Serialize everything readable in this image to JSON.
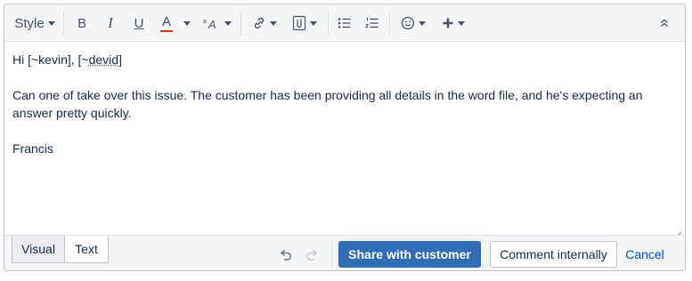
{
  "toolbar": {
    "style_label": "Style",
    "bold_label": "B",
    "italic_label": "I",
    "underline_label": "U",
    "text_color_label": "A",
    "text_color_value": "#de350b"
  },
  "content": {
    "line1_prefix": "Hi [~kevin], [~",
    "line1_misspelled": "devid",
    "line1_suffix": "]",
    "line2": "Can one of take over this issue.  The customer has been providing all details in the word file, and he's expecting an answer pretty quickly.",
    "line3": "Francis"
  },
  "footer": {
    "tab_visual": "Visual",
    "tab_text": "Text",
    "share_label": "Share with customer",
    "comment_label": "Comment internally",
    "cancel_label": "Cancel"
  },
  "colors": {
    "primary": "#2f6eb6",
    "link": "#0052cc",
    "toolbar_bg": "#f4f5f7"
  },
  "icons": [
    "chevron-down-icon",
    "text-size-icon",
    "link-icon",
    "attachment-icon",
    "bullet-list-icon",
    "numbered-list-icon",
    "emoji-icon",
    "plus-icon",
    "collapse-icon",
    "undo-icon",
    "redo-icon",
    "resize-handle-icon"
  ]
}
